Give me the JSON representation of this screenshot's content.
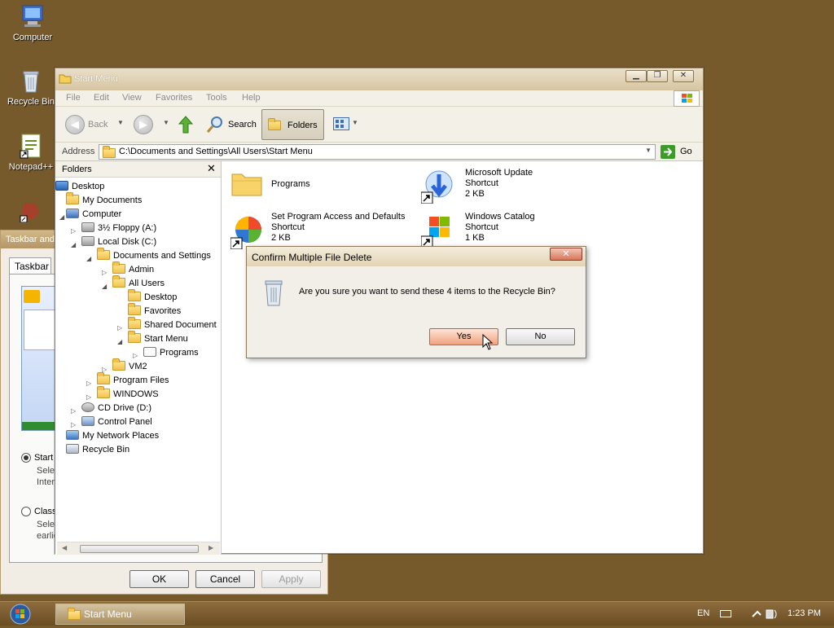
{
  "desktop": {
    "icons": [
      {
        "label": "Computer",
        "icon": "computer-icon"
      },
      {
        "label": "Recycle Bin",
        "icon": "recycle-bin-icon"
      },
      {
        "label": "Notepad++",
        "icon": "notepad-plus-plus-icon"
      }
    ]
  },
  "bg_dialog": {
    "title": "Taskbar and",
    "tab": "Taskbar",
    "option1": "Start",
    "option1_desc1": "Selec",
    "option1_desc2": "Interr",
    "option2": "Classi",
    "option2_desc1": "Selec",
    "option2_desc2": "earlie",
    "ok": "OK",
    "cancel": "Cancel",
    "apply": "Apply"
  },
  "explorer": {
    "title": "Start Menu",
    "menu": [
      "File",
      "Edit",
      "View",
      "Favorites",
      "Tools",
      "Help"
    ],
    "toolbar": {
      "back": "Back",
      "search": "Search",
      "folders": "Folders"
    },
    "address": {
      "label": "Address",
      "path": "C:\\Documents and Settings\\All Users\\Start Menu",
      "go": "Go"
    },
    "folders_pane": {
      "title": "Folders",
      "tree": [
        "Desktop",
        "My Documents",
        "Computer",
        "3½ Floppy (A:)",
        "Local Disk (C:)",
        "Documents and Settings",
        "Admin",
        "All Users",
        "Desktop",
        "Favorites",
        "Shared Document",
        "Start Menu",
        "Programs",
        "VM2",
        "Program Files",
        "WINDOWS",
        "CD Drive (D:)",
        "Control Panel",
        "My Network Places",
        "Recycle Bin"
      ]
    },
    "items": [
      {
        "name": "Programs",
        "type": "",
        "size": ""
      },
      {
        "name": "Microsoft Update",
        "type": "Shortcut",
        "size": "2 KB"
      },
      {
        "name": "Set Program Access and Defaults",
        "type": "Shortcut",
        "size": "2 KB"
      },
      {
        "name": "Windows Catalog",
        "type": "Shortcut",
        "size": "1 KB"
      }
    ]
  },
  "confirm": {
    "title": "Confirm Multiple File Delete",
    "message": "Are you sure you want to send these 4 items to the Recycle Bin?",
    "yes": "Yes",
    "no": "No"
  },
  "taskbar": {
    "task": "Start Menu",
    "lang": "EN",
    "time": "1:23 PM"
  }
}
